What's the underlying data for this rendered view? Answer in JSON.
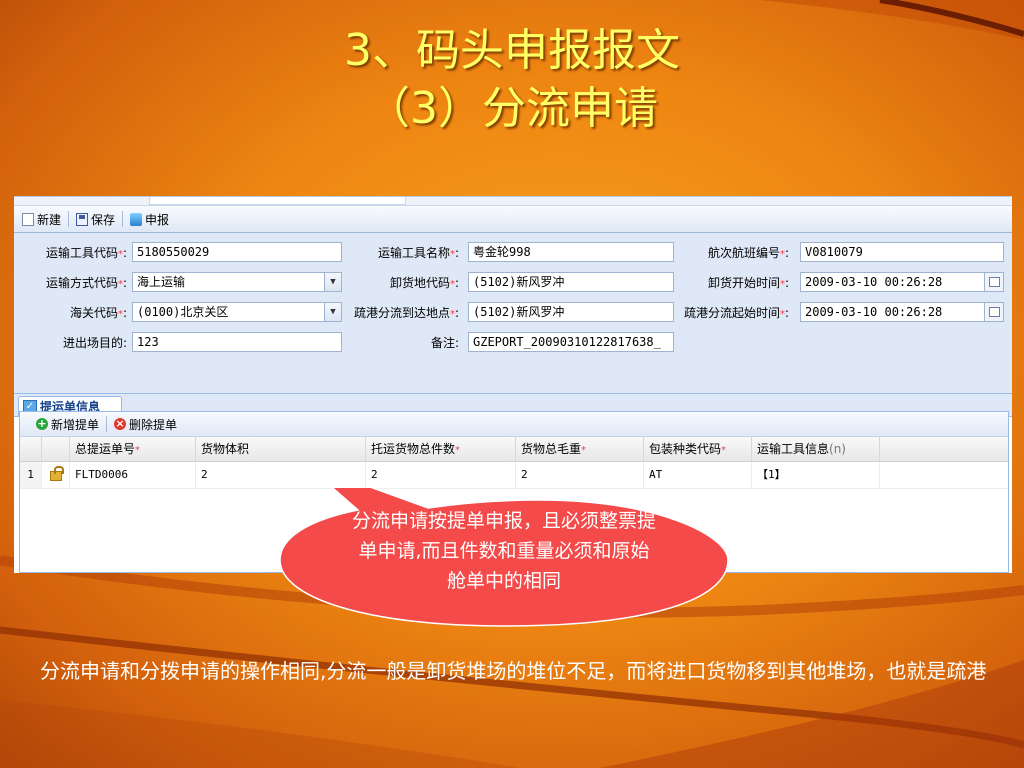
{
  "slide": {
    "title_line1": "3、码头申报报文",
    "title_line2": "（3）分流申请",
    "callout_text": "分流申请按提单申报，且必须整票提单申请,而且件数和重量必须和原始舱单中的相同",
    "bottom_text": "分流申请和分拨申请的操作相同,分流一般是卸货堆场的堆位不足，而将进口货物移到其他堆场，也就是疏港"
  },
  "toolbar": {
    "new_label": "新建",
    "save_label": "保存",
    "submit_label": "申报"
  },
  "form": {
    "transport_code": {
      "label": "运输工具代码",
      "value": "5180550029"
    },
    "transport_name": {
      "label": "运输工具名称",
      "value": "粤金轮998"
    },
    "voyage_no": {
      "label": "航次航班编号",
      "value": "V0810079"
    },
    "transport_mode": {
      "label": "运输方式代码",
      "value": "海上运输"
    },
    "unload_place": {
      "label": "卸货地代码",
      "value": "(5102)新风罗冲"
    },
    "unload_start": {
      "label": "卸货开始时间",
      "value": "2009-03-10 00:26:28"
    },
    "customs_code": {
      "label": "海关代码",
      "value": "(0100)北京关区"
    },
    "diversion_dest": {
      "label": "疏港分流到达地点",
      "value": "(5102)新风罗冲"
    },
    "diversion_start": {
      "label": "疏港分流起始时间",
      "value": "2009-03-10 00:26:28"
    },
    "purpose": {
      "label": "进出场目的",
      "value": "123"
    },
    "remark": {
      "label": "备注",
      "value": "GZEPORT_20090310122817638_"
    }
  },
  "tab": {
    "label": "提运单信息"
  },
  "grid": {
    "add_label": "新增提单",
    "delete_label": "删除提单",
    "columns": [
      "总提运单号",
      "货物体积",
      "托运货物总件数",
      "货物总毛重",
      "包装种类代码",
      "运输工具信息"
    ],
    "columns_required": [
      true,
      false,
      true,
      true,
      true,
      false
    ],
    "col6_suffix": "(n)",
    "rows": [
      {
        "num": "1",
        "bill_no": "FLTD0006",
        "volume": "2",
        "pieces": "2",
        "weight": "2",
        "pack_code": "AT",
        "transport_info": "【1】"
      }
    ]
  }
}
